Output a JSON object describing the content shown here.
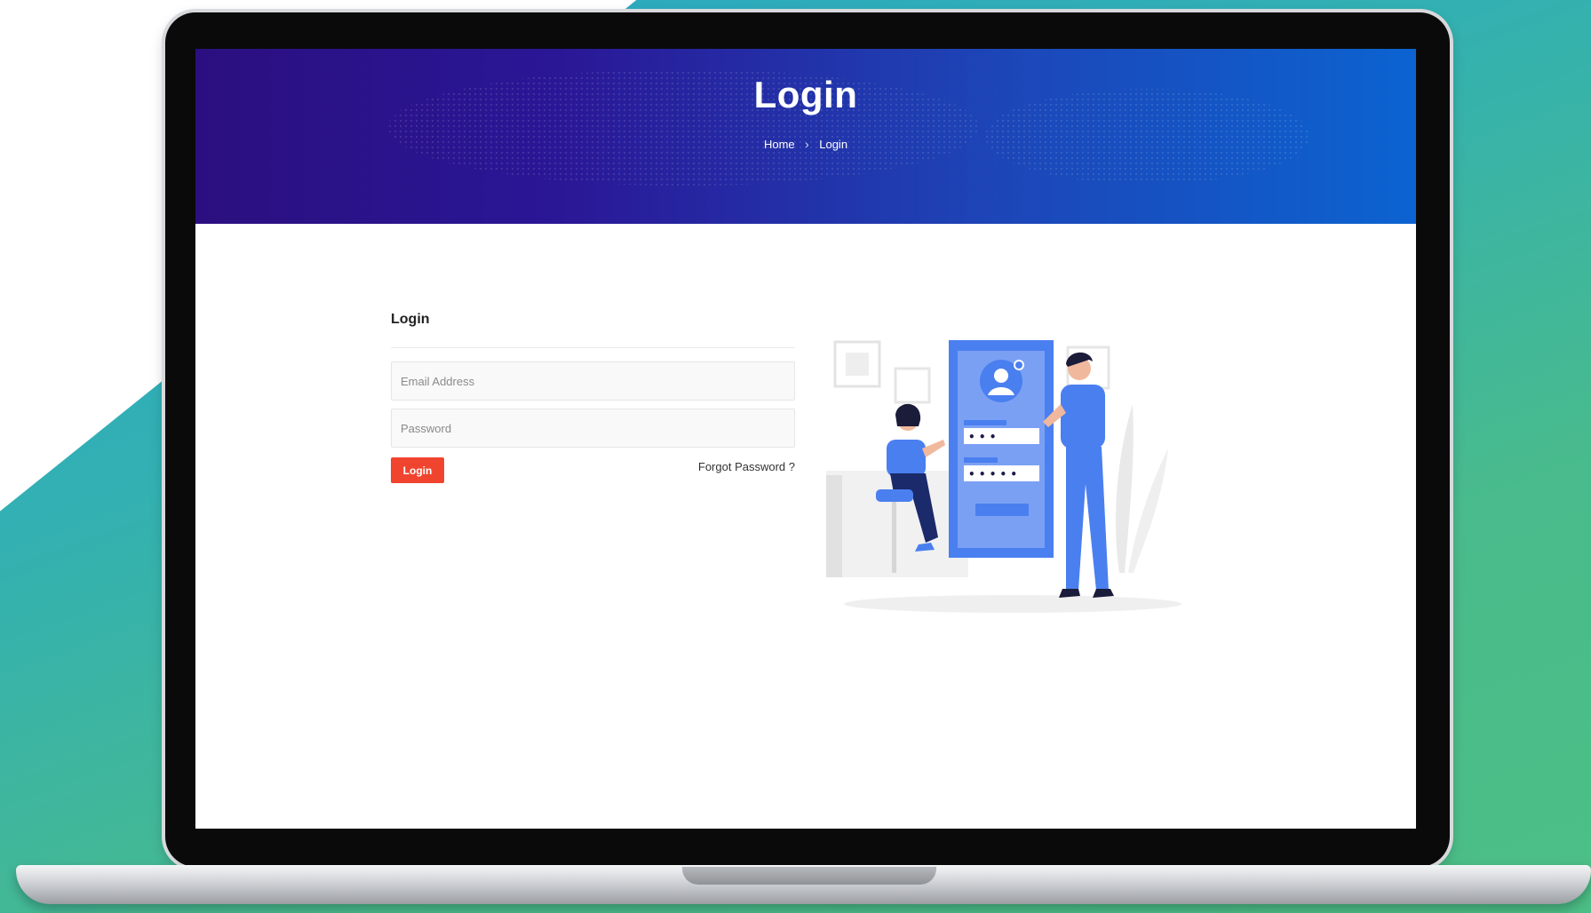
{
  "hero": {
    "title": "Login",
    "breadcrumb": {
      "home": "Home",
      "separator": "›",
      "current": "Login"
    }
  },
  "form": {
    "title": "Login",
    "email_placeholder": "Email Address",
    "password_placeholder": "Password",
    "login_button": "Login",
    "forgot_password": "Forgot Password ?"
  },
  "illustration": {
    "password_dots_1": "• • •",
    "password_dots_2": "• • • • •"
  },
  "colors": {
    "hero_start": "#2b0f80",
    "hero_end": "#0c63d1",
    "button": "#f0442f",
    "illustration_blue": "#4a7ff0",
    "background_teal": "#32b0b3"
  }
}
